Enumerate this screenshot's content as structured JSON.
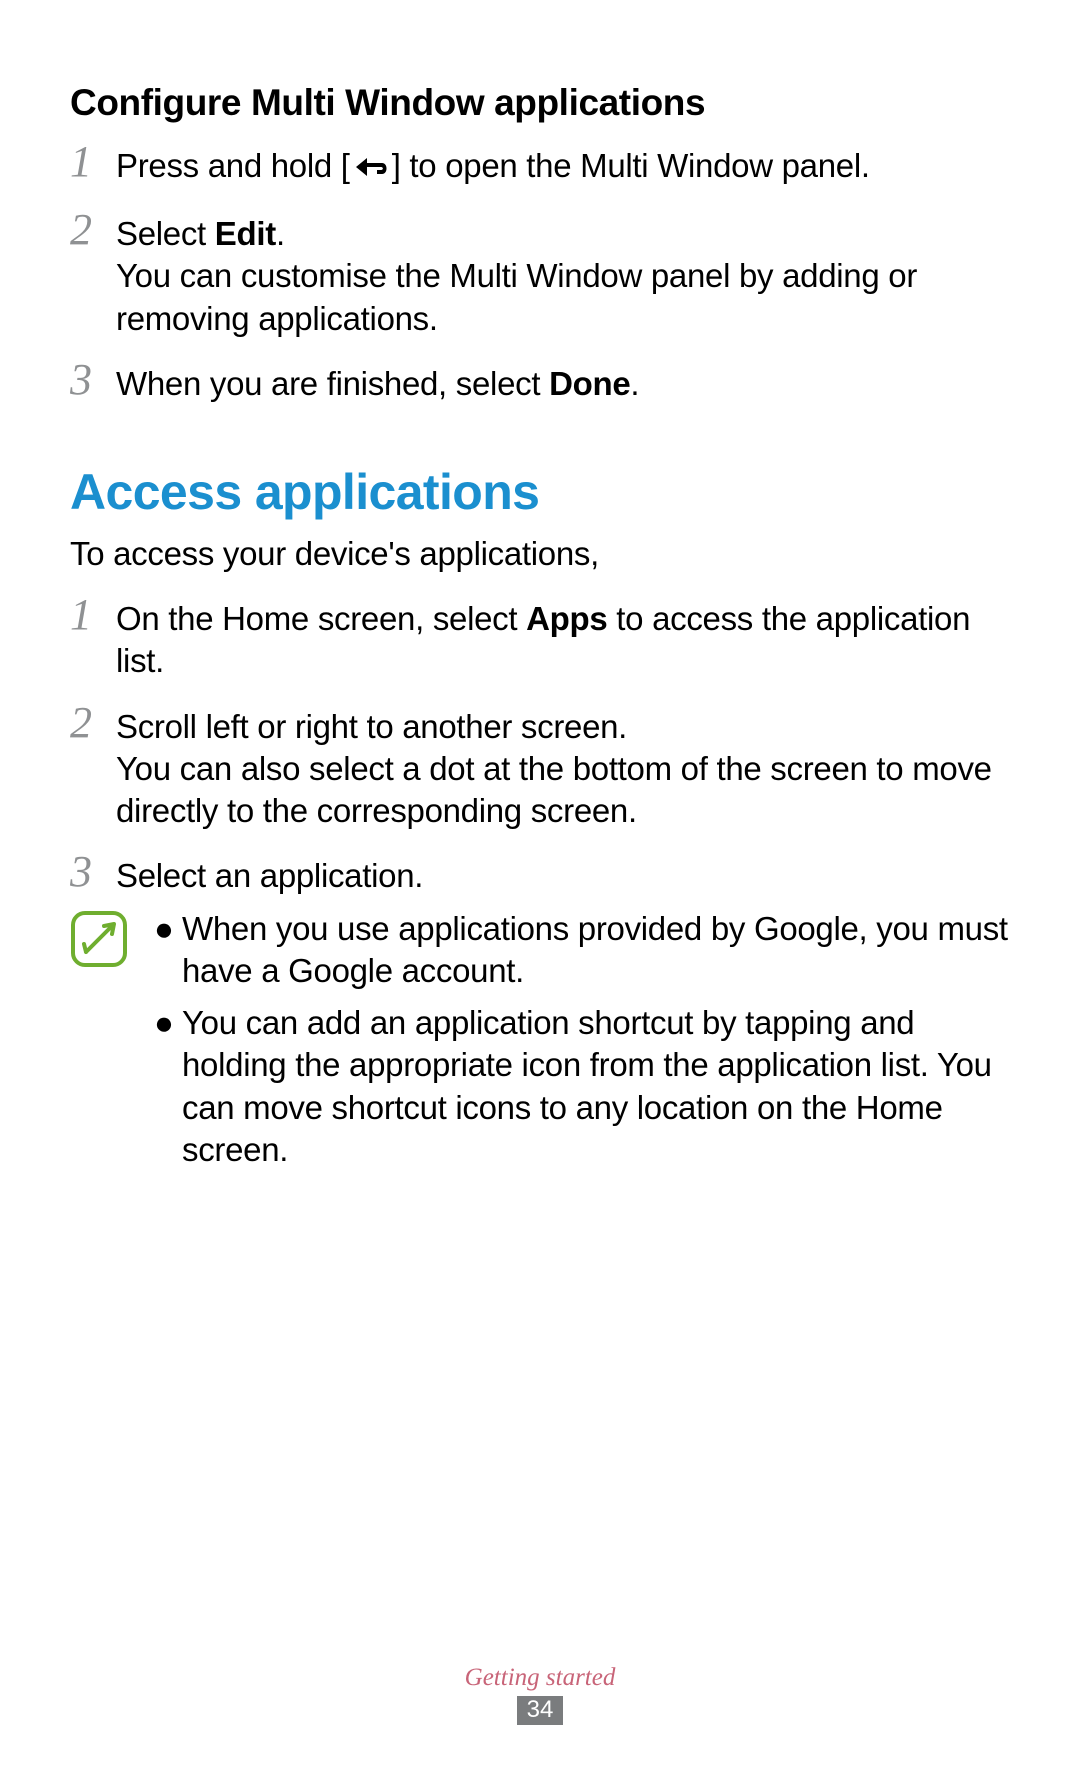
{
  "sectionA": {
    "heading": "Configure Multi Window applications",
    "steps": [
      {
        "num": "1",
        "text_before": "Press and hold [",
        "text_after": "] to open the Multi Window panel."
      },
      {
        "num": "2",
        "line1_before": "Select ",
        "line1_bold": "Edit",
        "line1_after": ".",
        "line2": "You can customise the Multi Window panel by adding or removing applications."
      },
      {
        "num": "3",
        "text_before": "When you are finished, select ",
        "text_bold": "Done",
        "text_after": "."
      }
    ]
  },
  "sectionB": {
    "title": "Access applications",
    "intro": "To access your device's applications,",
    "steps": [
      {
        "num": "1",
        "text_before": "On the Home screen, select ",
        "text_bold": "Apps",
        "text_after": " to access the application list."
      },
      {
        "num": "2",
        "line1": "Scroll left or right to another screen.",
        "line2": "You can also select a dot at the bottom of the screen to move directly to the corresponding screen."
      },
      {
        "num": "3",
        "text": "Select an application."
      }
    ],
    "notes": [
      "When you use applications provided by Google, you must have a Google account.",
      "You can add an application shortcut by tapping and holding the appropriate icon from the application list. You can move shortcut icons to any location on the Home screen."
    ]
  },
  "footer": {
    "section": "Getting started",
    "page": "34"
  }
}
